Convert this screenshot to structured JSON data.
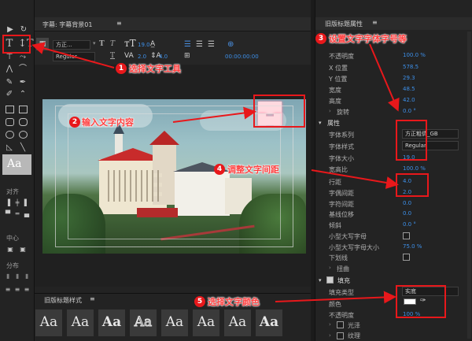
{
  "editor": {
    "tab_title": "字幕: 字幕背景01",
    "font_name": "方正...",
    "font_style": "Regular",
    "font_size": "19.0",
    "kerning": "2.0",
    "leading": "4.0",
    "timecode": "00:00:00:00"
  },
  "styles_panel": {
    "title": "旧版标题样式",
    "swatches": [
      "Aa",
      "Aa",
      "Aa",
      "Aa",
      "Aa",
      "Aa",
      "Aa",
      "Aa"
    ]
  },
  "properties": {
    "title": "旧版标题属性",
    "rows": [
      {
        "label": "不透明度",
        "value": "100.0 %"
      },
      {
        "label": "X 位置",
        "value": "578.5"
      },
      {
        "label": "Y 位置",
        "value": "29.3"
      },
      {
        "label": "宽度",
        "value": "48.5"
      },
      {
        "label": "高度",
        "value": "42.0"
      },
      {
        "label": "旋转",
        "value": "0.0 °"
      }
    ],
    "attributes_title": "属性",
    "attr_rows": [
      {
        "label": "字体系列",
        "value": "方正粗倩_GB"
      },
      {
        "label": "字体样式",
        "value": "Regular"
      },
      {
        "label": "字体大小",
        "value": "19.0"
      },
      {
        "label": "宽高比",
        "value": "100.0 %"
      },
      {
        "label": "行距",
        "value": "4.0"
      },
      {
        "label": "字偶间距",
        "value": "2.0"
      },
      {
        "label": "字符间距",
        "value": "0.0"
      },
      {
        "label": "基线位移",
        "value": "0.0"
      },
      {
        "label": "倾斜",
        "value": "0.0 °"
      },
      {
        "label": "小型大写字母",
        "value": ""
      },
      {
        "label": "小型大写字母大小",
        "value": "75.0 %"
      },
      {
        "label": "下划线",
        "value": ""
      }
    ],
    "distort_label": "扭曲",
    "fill_title": "填充",
    "fill_rows": [
      {
        "label": "填充类型",
        "value": "实底"
      },
      {
        "label": "颜色",
        "value": ""
      },
      {
        "label": "不透明度",
        "value": "100 %"
      }
    ],
    "sheen_label": "光泽",
    "texture_label": "纹理"
  },
  "left_panel": {
    "align_label": "对齐",
    "center_label": "中心",
    "distribute_label": "分布",
    "style_preview": "Aa"
  },
  "annotations": [
    {
      "num": "1",
      "text": "选择文字工具"
    },
    {
      "num": "2",
      "text": "输入文字内容"
    },
    {
      "num": "3",
      "text": "设置文字字体字号等"
    },
    {
      "num": "4",
      "text": "调整文字间距"
    },
    {
      "num": "5",
      "text": "选择文字颜色"
    }
  ],
  "colors": {
    "accent": "#3d8fe8",
    "annotation": "#e8181b",
    "panel": "#232323"
  }
}
